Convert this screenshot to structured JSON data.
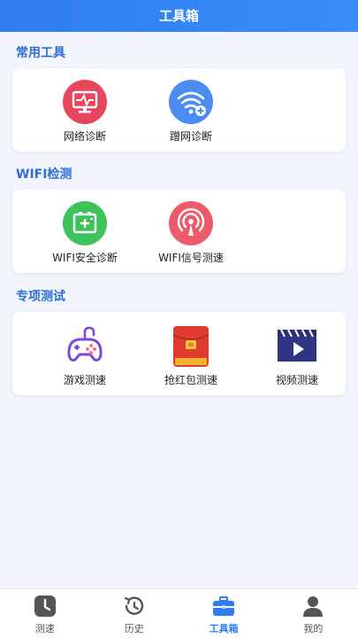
{
  "header": {
    "title": "工具箱"
  },
  "sections": [
    {
      "title": "常用工具",
      "items": [
        {
          "label": "网络诊断",
          "icon": "monitor-pulse-icon"
        },
        {
          "label": "蹭网诊断",
          "icon": "wifi-plus-icon"
        }
      ]
    },
    {
      "title": "WIFI检测",
      "items": [
        {
          "label": "WIFI安全诊断",
          "icon": "battery-shield-icon"
        },
        {
          "label": "WIFI信号测速",
          "icon": "signal-tower-icon"
        }
      ]
    },
    {
      "title": "专项测试",
      "items": [
        {
          "label": "游戏测速",
          "icon": "gamepad-icon"
        },
        {
          "label": "抢红包测速",
          "icon": "red-envelope-icon"
        },
        {
          "label": "视频测速",
          "icon": "video-clapper-icon"
        }
      ]
    }
  ],
  "tabbar": {
    "items": [
      {
        "label": "测速",
        "icon": "speed-clock-icon",
        "active": false
      },
      {
        "label": "历史",
        "icon": "history-icon",
        "active": false
      },
      {
        "label": "工具箱",
        "icon": "toolbox-icon",
        "active": true
      },
      {
        "label": "我的",
        "icon": "profile-icon",
        "active": false
      }
    ]
  },
  "colors": {
    "accent": "#2f7df0",
    "section_title": "#2f6fd6",
    "background": "#f2f5fb"
  }
}
